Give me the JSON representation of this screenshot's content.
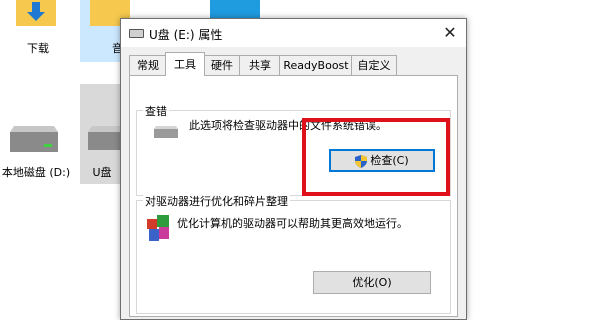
{
  "desktop": {
    "folders": [
      {
        "label": "下载",
        "icon": "download-folder-icon"
      },
      {
        "label": "音",
        "icon": "music-folder-icon"
      }
    ],
    "drives": [
      {
        "label": "本地磁盘 (D:)",
        "icon": "hard-drive-icon"
      },
      {
        "label": "U盘",
        "icon": "usb-drive-icon"
      }
    ]
  },
  "dialog": {
    "title": "U盘 (E:) 属性",
    "close_glyph": "✕",
    "tabs": [
      "常规",
      "工具",
      "硬件",
      "共享",
      "ReadyBoost",
      "自定义"
    ],
    "active_tab": "工具",
    "error_check": {
      "group_title": "查错",
      "description": "此选项将检查驱动器中的文件系统错误。",
      "button_label": "检查(C)"
    },
    "optimize": {
      "group_title": "对驱动器进行优化和碎片整理",
      "description": "优化计算机的驱动器可以帮助其更高效地运行。",
      "button_label": "优化(O)"
    }
  },
  "colors": {
    "highlight": "#e0101a",
    "folder": "#f6c94e",
    "selection": "#cce8ff",
    "accent": "#0078d7"
  }
}
